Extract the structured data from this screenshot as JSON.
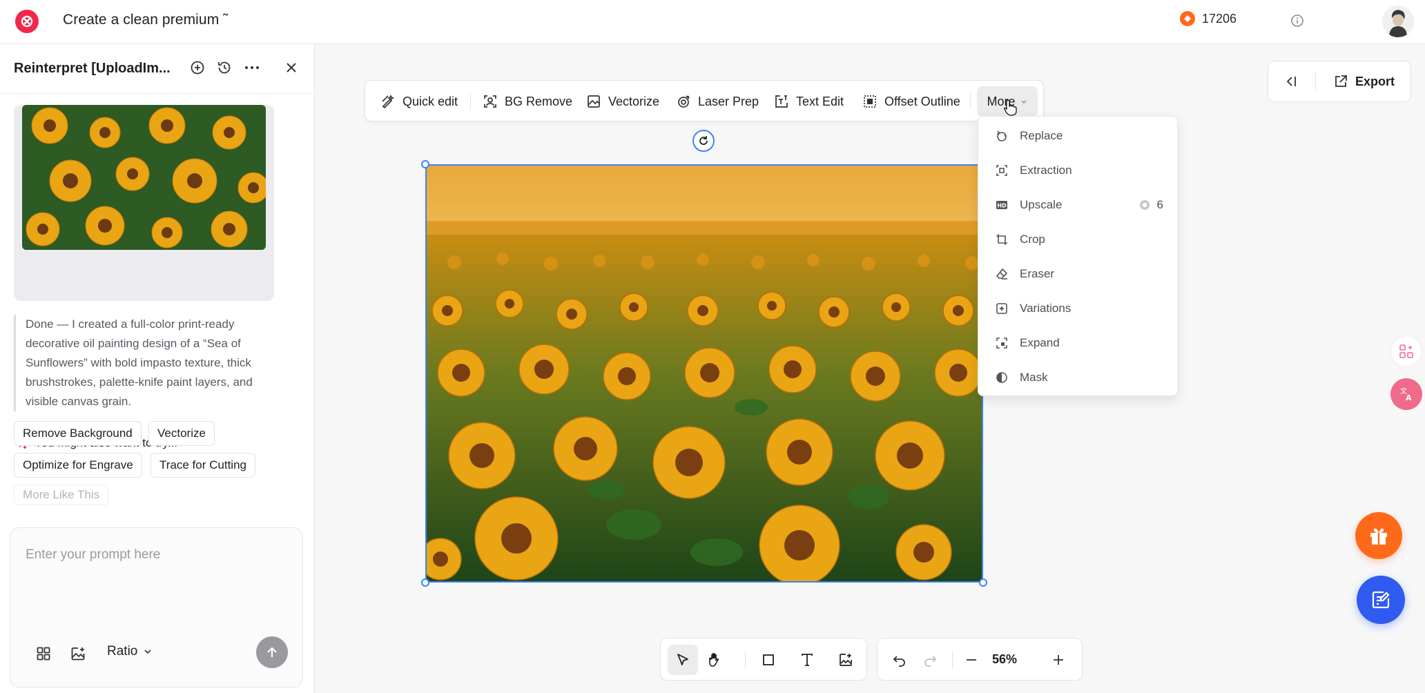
{
  "topbar": {
    "doc_title": "Create a clean premium ˜",
    "credits": "17206",
    "logo_icon": "brand-logo-icon",
    "coin_icon": "coin-icon",
    "info_icon": "info-icon",
    "avatar_icon": "user-avatar-icon"
  },
  "panel": {
    "title": "Reinterpret [UploadIm...",
    "message": "Done — I created a full-color print-ready decorative oil painting design of a “Sea of Sunflowers” with bold impasto texture, thick brushstrokes, palette-knife paint layers, and visible canvas grain.",
    "suggest_title": "You might also want to try...",
    "chips": [
      "Remove Background",
      "Vectorize",
      "Optimize for Engrave",
      "Trace for Cutting",
      "More Like This"
    ],
    "prompt_placeholder": "Enter your prompt here",
    "ratio_label": "Ratio"
  },
  "toolbar": {
    "items": [
      "Quick edit",
      "BG Remove",
      "Vectorize",
      "Laser Prep",
      "Text Edit",
      "Offset Outline"
    ],
    "more_label": "More"
  },
  "export": {
    "label": "Export"
  },
  "dropdown": {
    "items": [
      "Replace",
      "Extraction",
      "Upscale",
      "Crop",
      "Eraser",
      "Variations",
      "Expand",
      "Mask"
    ],
    "upscale_cost": "6"
  },
  "zoom": {
    "level": "56%"
  },
  "colors": {
    "accent": "#3b82f6",
    "brand": "#f0284a",
    "coin": "#ff6a1a",
    "feedback": "#2f5bf0"
  }
}
